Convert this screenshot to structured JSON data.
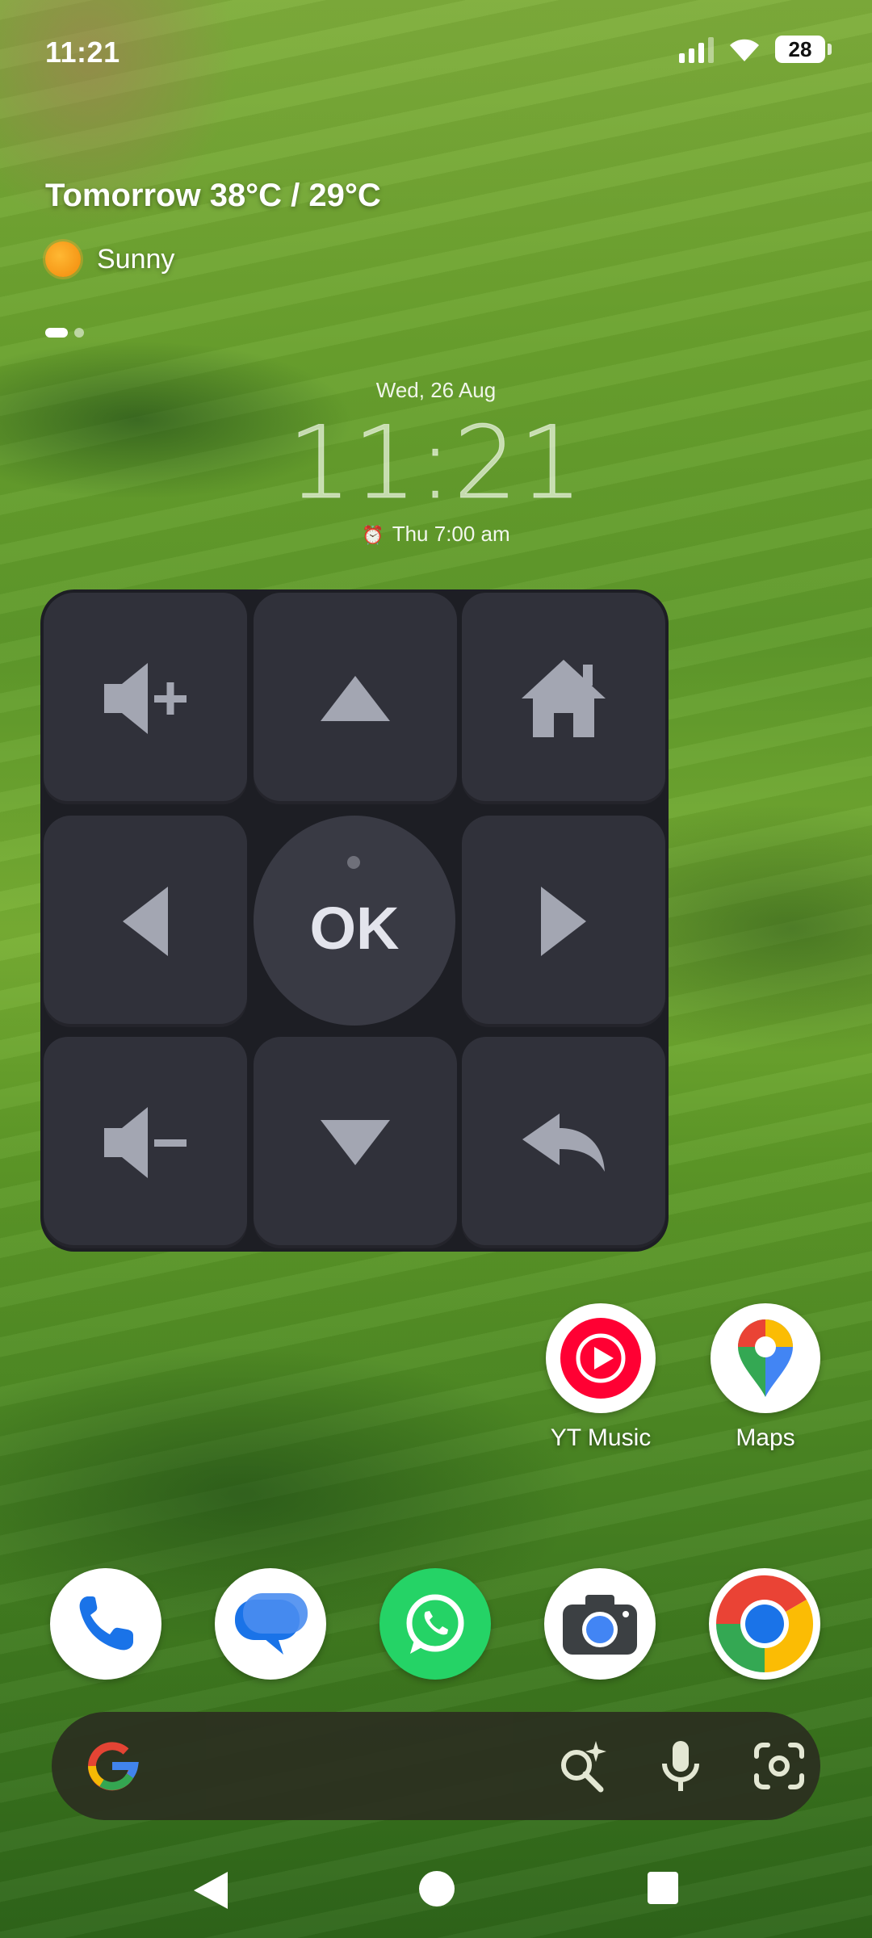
{
  "status_bar": {
    "time": "11:21",
    "battery_level": "28",
    "icons": [
      "signal-icon",
      "wifi-icon",
      "battery-icon"
    ]
  },
  "weather": {
    "forecast": "Tomorrow 38°C / 29°C",
    "condition": "Sunny",
    "icon": "sun-icon"
  },
  "clock": {
    "date": "Wed, 26 Aug",
    "time": "11:21",
    "alarm": "Thu 7:00 am",
    "alarm_icon": "alarm-icon"
  },
  "remote": {
    "ok_label": "OK",
    "buttons": [
      "volume-up",
      "up",
      "home",
      "left",
      "ok",
      "right",
      "volume-down",
      "down",
      "back"
    ],
    "colors": {
      "panel": "#1d1e24",
      "button": "#30313a",
      "glyph": "#a3a6b2"
    }
  },
  "home_apps": [
    {
      "label": "YT Music",
      "icon": "yt-music-icon"
    },
    {
      "label": "Maps",
      "icon": "maps-icon"
    }
  ],
  "dock": [
    "phone-icon",
    "messages-icon",
    "whatsapp-icon",
    "camera-icon",
    "chrome-icon"
  ],
  "search": {
    "logo": "google-g-icon",
    "tools": [
      "ai-search-icon",
      "microphone-icon",
      "lens-icon"
    ]
  },
  "navigation": [
    "back-icon",
    "home-icon",
    "recents-icon"
  ]
}
